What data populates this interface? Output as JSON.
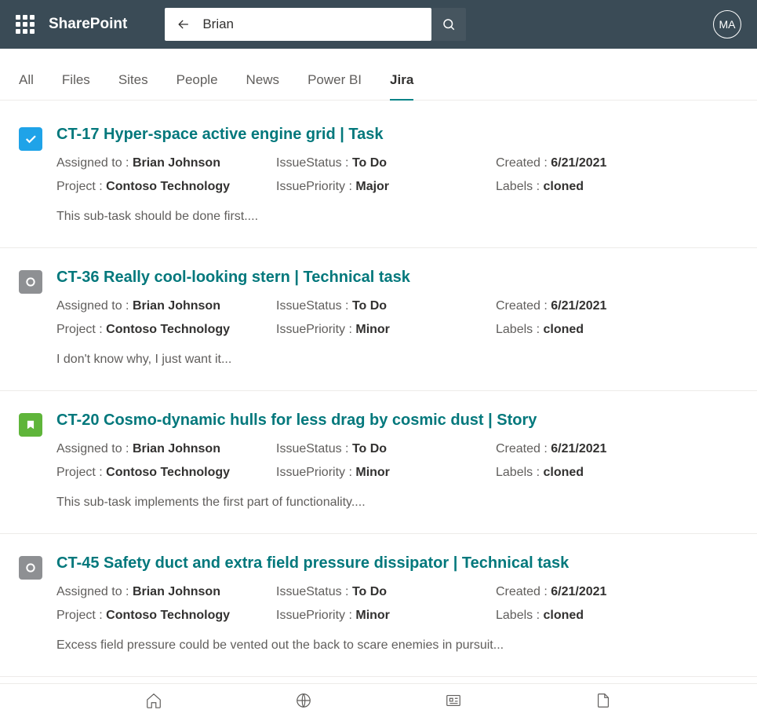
{
  "header": {
    "app_name": "SharePoint",
    "search_value": "Brian",
    "avatar_initials": "MA"
  },
  "tabs": [
    "All",
    "Files",
    "Sites",
    "People",
    "News",
    "Power BI",
    "Jira"
  ],
  "active_tab": "Jira",
  "labels": {
    "assigned_to": "Assigned to : ",
    "project": "Project : ",
    "status": "IssueStatus : ",
    "priority": "IssuePriority : ",
    "created": "Created : ",
    "labels": "Labels : "
  },
  "results": [
    {
      "icon": "task",
      "title": "CT-17 Hyper-space active engine grid | Task",
      "assigned_to": "Brian Johnson",
      "project": "Contoso Technology",
      "status": "To Do",
      "priority": "Major",
      "created": "6/21/2021",
      "labels": "cloned",
      "description": "This sub-task should be done first...."
    },
    {
      "icon": "tech",
      "title": "CT-36 Really cool-looking stern | Technical task",
      "assigned_to": "Brian Johnson",
      "project": "Contoso Technology",
      "status": "To Do",
      "priority": "Minor",
      "created": "6/21/2021",
      "labels": "cloned",
      "description": "I don't know why, I just want it..."
    },
    {
      "icon": "story",
      "title": "CT-20 Cosmo-dynamic hulls for less drag by cosmic dust | Story",
      "assigned_to": "Brian Johnson",
      "project": "Contoso Technology",
      "status": "To Do",
      "priority": "Minor",
      "created": "6/21/2021",
      "labels": "cloned",
      "description": "This sub-task implements the first part of functionality...."
    },
    {
      "icon": "tech",
      "title": "CT-45 Safety duct and extra field pressure dissipator | Technical task",
      "assigned_to": "Brian Johnson",
      "project": "Contoso Technology",
      "status": "To Do",
      "priority": "Minor",
      "created": "6/21/2021",
      "labels": "cloned",
      "description": "Excess field pressure could be vented out the back to scare enemies in pursuit..."
    }
  ]
}
